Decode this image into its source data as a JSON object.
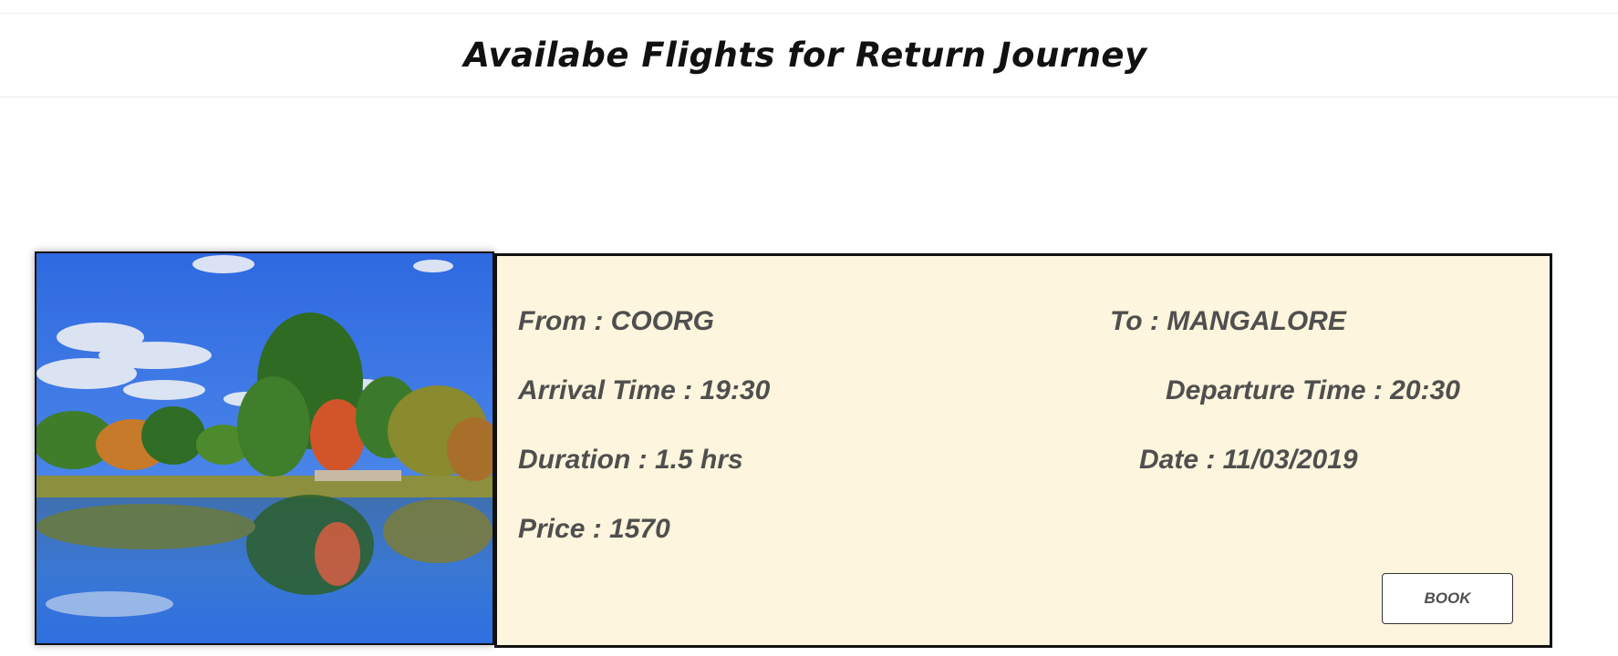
{
  "page": {
    "title": "Availabe Flights for Return Journey"
  },
  "flight": {
    "from": "From : COORG",
    "to": "To : MANGALORE",
    "arrival": "Arrival Time : 19:30",
    "departure": "Departure Time : 20:30",
    "duration": "Duration : 1.5 hrs",
    "date": "Date : 11/03/2019",
    "price": "Price : 1570",
    "book_label": "BOOK"
  },
  "colors": {
    "card_background": "#fdf5dd",
    "field_text": "#4f4f4f",
    "card_border": "#111111"
  }
}
